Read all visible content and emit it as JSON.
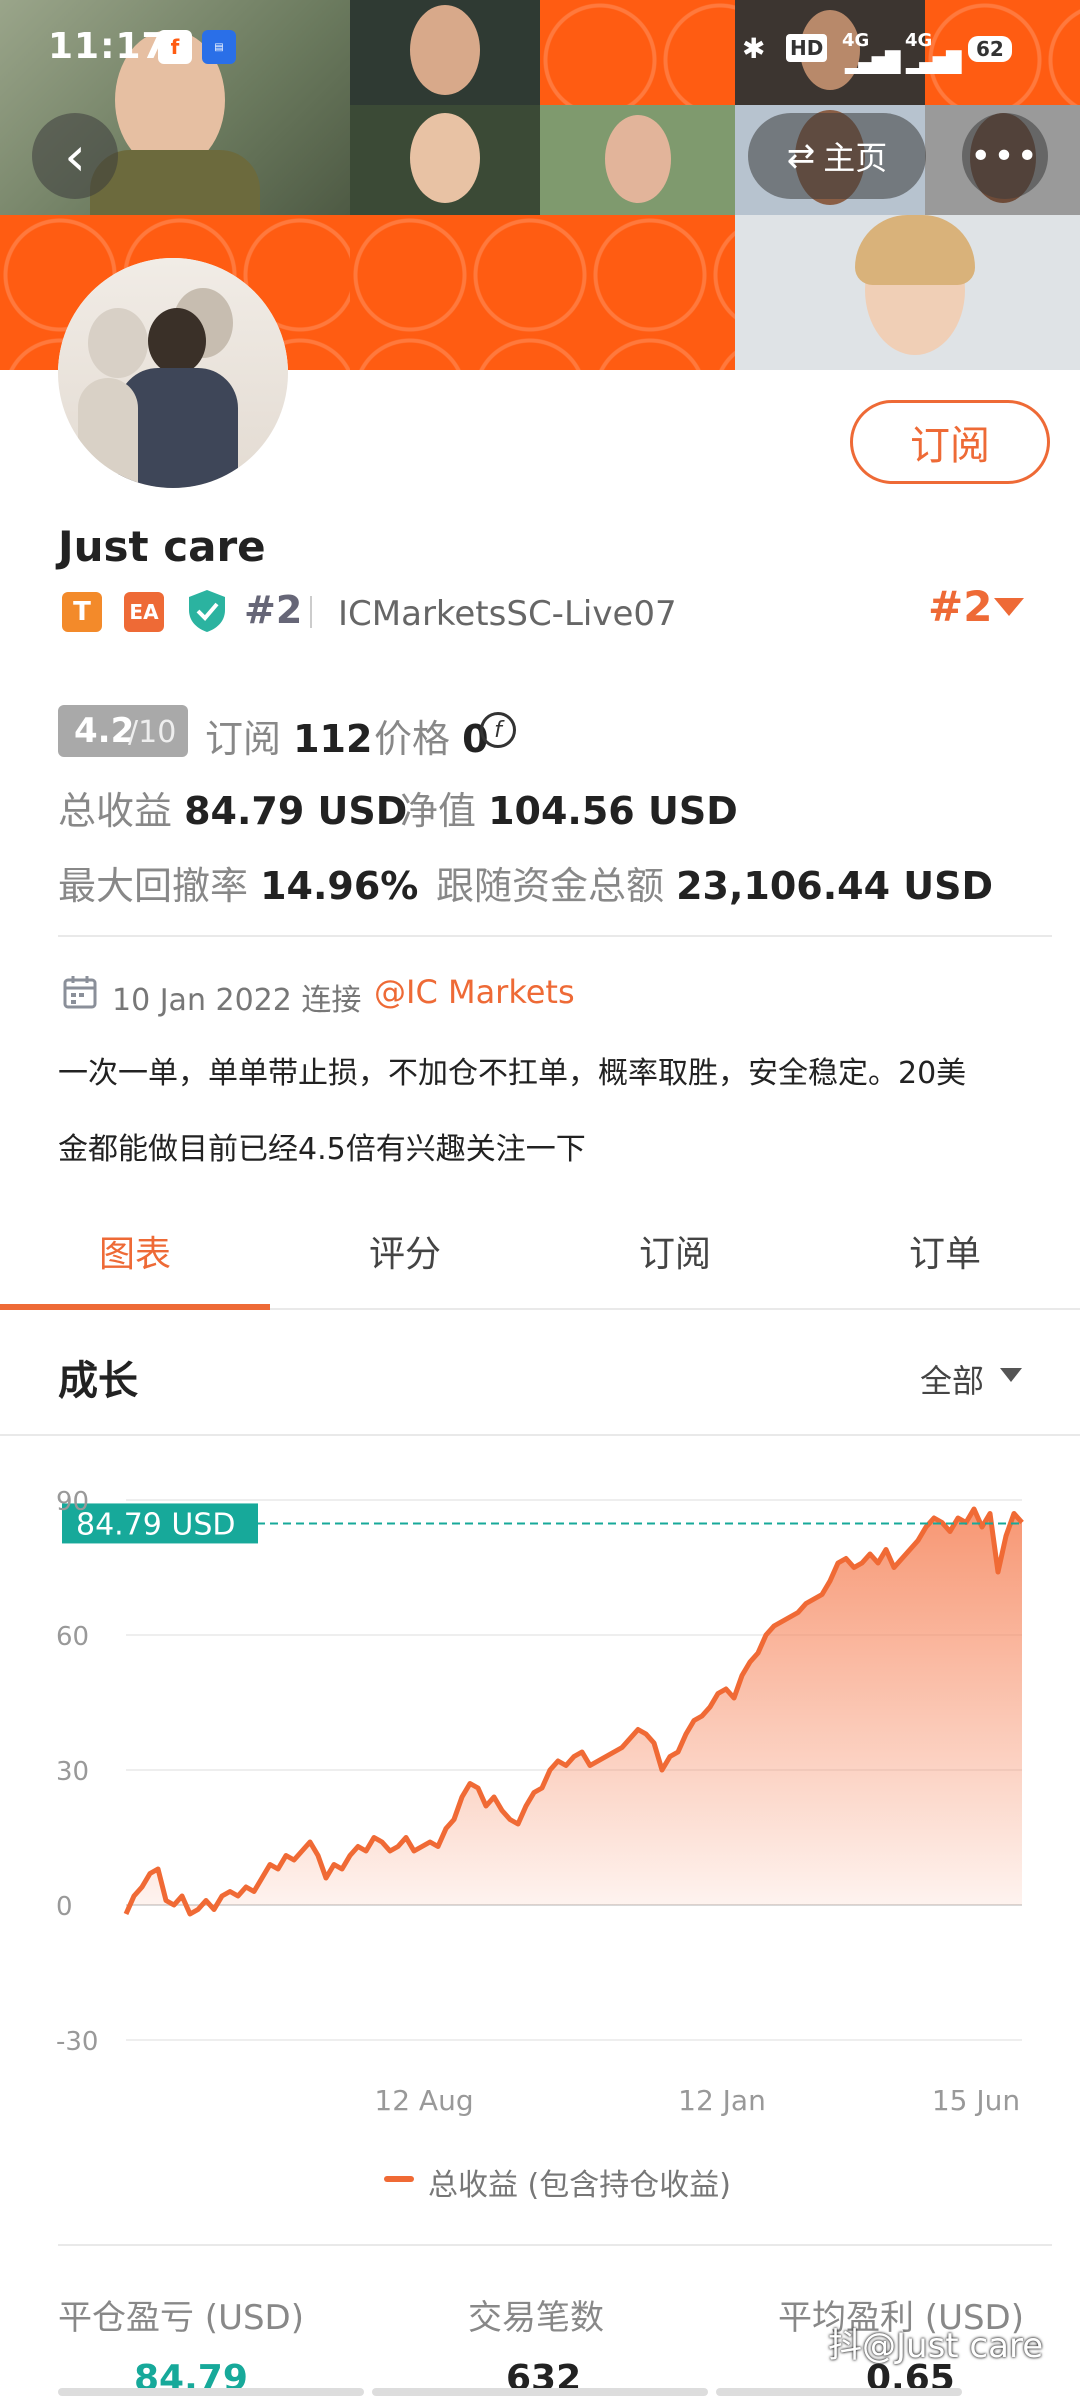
{
  "statusbar": {
    "time": "11:17",
    "app_icon_1": "fxcm-app-icon",
    "app_icon_2": "notification-app-icon",
    "signal_1": "4G",
    "signal_2": "4G",
    "hd_label": "HD",
    "battery": "62"
  },
  "nav": {
    "back_icon": "chevron-left-icon",
    "home_label": "主页",
    "home_icon": "swap-arrows-icon",
    "more_icon": "more-dots-icon"
  },
  "profile": {
    "name": "Just care",
    "badge_t": "T",
    "badge_ea": "EA",
    "rank": "#2",
    "server": "ICMarketsSC-Live07",
    "rank_right": "#2",
    "subscribe_label": "订阅"
  },
  "stats": {
    "rating": "4.2",
    "rating_max": "/10",
    "subs_label": "订阅",
    "subs_value": "112",
    "price_label": "价格",
    "price_value": "0",
    "total_profit_label": "总收益",
    "total_profit_value": "84.79 USD",
    "equity_label": "净值",
    "equity_value": "104.56 USD",
    "drawdown_label": "最大回撤率",
    "drawdown_value": "14.96%",
    "follow_label": "跟随资金总额",
    "follow_value": "23,106.44 USD"
  },
  "connect": {
    "date": "10 Jan 2022",
    "connect_word": "连接",
    "broker": "@IC Markets",
    "desc_line1": "一次一单，单单带止损，不加仓不扛单，概率取胜，安全稳定。20美",
    "desc_line2": "金都能做目前已经4.5倍有兴趣关注一下"
  },
  "tabs": [
    {
      "label": "图表",
      "active": true
    },
    {
      "label": "评分",
      "active": false
    },
    {
      "label": "订阅",
      "active": false
    },
    {
      "label": "订单",
      "active": false
    }
  ],
  "growth": {
    "title": "成长",
    "filter": "全部"
  },
  "chart_data": {
    "type": "area",
    "title": "",
    "xlabel": "",
    "ylabel": "",
    "ylim": [
      -30,
      90
    ],
    "yticks": [
      90,
      60,
      30,
      0,
      -30
    ],
    "xticks": [
      "12 Aug",
      "12 Jan",
      "15 Jun"
    ],
    "current_label": "84.79 USD",
    "current_value": 84.79,
    "legend": "总收益 (包含持仓收益)",
    "color": "#f06a35",
    "series": [
      {
        "name": "总收益 (包含持仓收益)",
        "values": [
          -2,
          2,
          4,
          7,
          8,
          1,
          0,
          2,
          -2,
          -1,
          1,
          -1,
          2,
          3,
          2,
          4,
          3,
          6,
          9,
          8,
          11,
          10,
          12,
          14,
          11,
          6,
          9,
          8,
          11,
          13,
          12,
          15,
          14,
          12,
          13,
          15,
          12,
          13,
          14,
          13,
          17,
          19,
          24,
          27,
          26,
          22,
          24,
          21,
          19,
          18,
          22,
          25,
          26,
          30,
          32,
          31,
          33,
          34,
          31,
          32,
          33,
          34,
          35,
          37,
          39,
          38,
          36,
          30,
          33,
          34,
          38,
          41,
          42,
          44,
          47,
          48,
          46,
          51,
          54,
          56,
          60,
          62,
          63,
          64,
          65,
          67,
          68,
          69,
          72,
          76,
          77,
          75,
          76,
          78,
          76,
          79,
          75,
          77,
          79,
          81,
          84,
          86,
          85,
          83,
          86,
          85,
          88,
          84,
          87,
          74,
          82,
          87,
          85
        ]
      }
    ]
  },
  "footer": {
    "closed_pl_label": "平仓盈亏 (USD)",
    "closed_pl_value": "84.79",
    "trades_label": "交易笔数",
    "trades_value": "632",
    "avg_profit_label": "平均盈利 (USD)",
    "avg_profit_value": "0.65",
    "watermark": "抖@Just care"
  },
  "colors": {
    "accent": "#ee6a36",
    "teal": "#17a99a",
    "banner": "#ff5c12"
  }
}
